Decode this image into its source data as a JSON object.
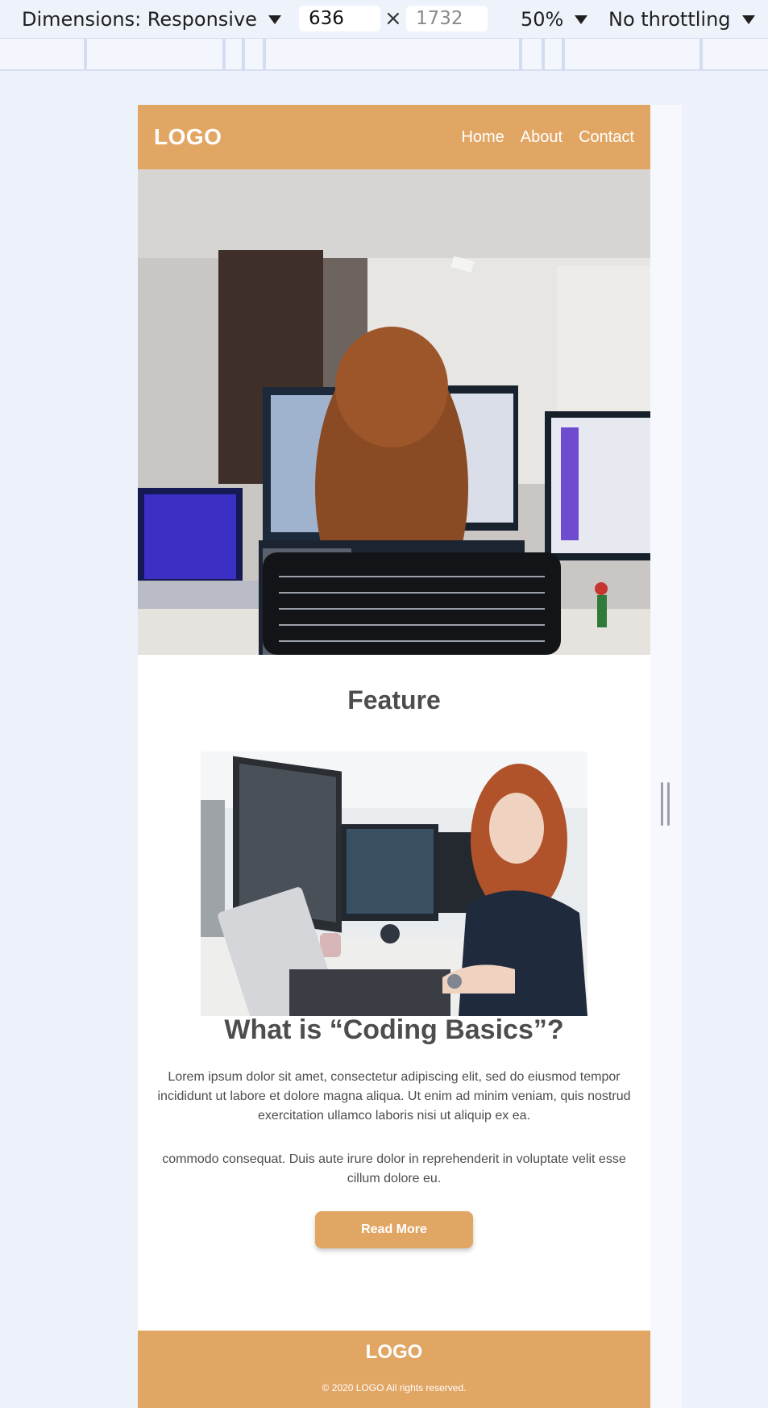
{
  "devtools": {
    "dimensions_label": "Dimensions: Responsive",
    "width_value": "636",
    "height_placeholder": "1732",
    "times_symbol": "×",
    "zoom_label": "50%",
    "throttling_label": "No throttling"
  },
  "page": {
    "header": {
      "logo": "LOGO",
      "nav": [
        "Home",
        "About",
        "Contact"
      ]
    },
    "hero_alt": "woman-at-computer-workspace",
    "feature_heading": "Feature",
    "feature_img_alt": "woman-coding-at-desk",
    "article": {
      "title": "What is “Coding Basics”?",
      "paragraph1": "Lorem ipsum dolor sit amet, consectetur adipiscing elit, sed do eiusmod tempor incididunt ut labore et dolore magna aliqua. Ut enim ad minim veniam, quis nostrud exercitation ullamco laboris nisi ut aliquip ex ea.",
      "paragraph2": "commodo consequat. Duis aute irure dolor in reprehenderit in voluptate velit esse cillum dolore eu.",
      "button_label": "Read More"
    },
    "footer": {
      "logo": "LOGO",
      "copyright": "© 2020 LOGO All rights reserved."
    }
  },
  "colors": {
    "brand": "#e2a664",
    "text": "#4d4d4d",
    "devtools_bg": "#eef2fa"
  }
}
